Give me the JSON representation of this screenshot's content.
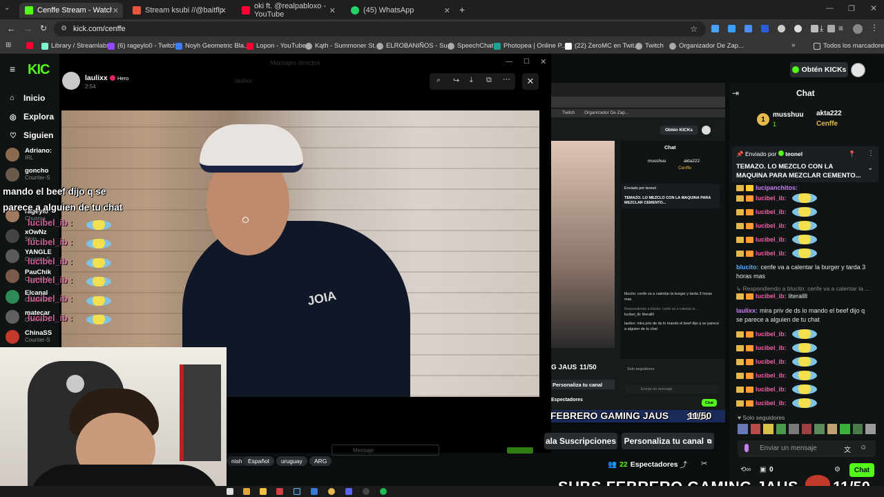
{
  "browser": {
    "tabs": [
      {
        "title": "Cenffe Stream - Watch Live on K",
        "color": "#53fc18",
        "active": true
      },
      {
        "title": "Stream ksubi //@baitflp",
        "color": "#e8553a",
        "active": false
      },
      {
        "title": "oki ft. @realpabloxo - YouTube",
        "color": "#ff0033",
        "active": false
      },
      {
        "title": "(45) WhatsApp",
        "color": "#25d366",
        "active": false
      }
    ],
    "url": "kick.com/cenffe",
    "bookmarks": [
      {
        "label": "",
        "color": "#ff0033"
      },
      {
        "label": "Library / Streamlabs",
        "color": "#80f5d2"
      },
      {
        "label": "(6) rageylo0 - Twitch",
        "color": "#9146ff"
      },
      {
        "label": "Noyh Geometric Bla...",
        "color": "#3c7cff"
      },
      {
        "label": "Lopon - YouTube",
        "color": "#ff0033"
      },
      {
        "label": "Kąth - Summoner St...",
        "color": "#aaaaaa"
      },
      {
        "label": "ELROBANIÑOS - Su...",
        "color": "#aaaaaa"
      },
      {
        "label": "SpeechChat",
        "color": "#aaaaaa"
      },
      {
        "label": "Photopea | Online P...",
        "color": "#18a497"
      },
      {
        "label": "(22) ZeroMC en Twit...",
        "color": "#ffffff"
      },
      {
        "label": "Twitch",
        "color": "#aaaaaa"
      },
      {
        "label": "Organizador De Zap...",
        "color": "#aaaaaa"
      }
    ],
    "all_bookmarks": "Todos los marcadores"
  },
  "sidebar": {
    "nav": [
      {
        "label": "Inicio",
        "icon": "home-icon"
      },
      {
        "label": "Explora",
        "icon": "compass-icon"
      },
      {
        "label": "Siguien",
        "icon": "heart-icon"
      }
    ],
    "channels": [
      {
        "name": "Adriano:",
        "sub": "IRL",
        "color": "#8c6a4f"
      },
      {
        "name": "goncho",
        "sub": "Counter-S",
        "color": "#6b5a4a"
      },
      {
        "name": "lucibel_ib",
        "sub": "Convers",
        "color": "#4c4c4c"
      },
      {
        "name": "rageylo",
        "sub": "Chusma",
        "color": "#a07a60"
      },
      {
        "name": "xOwNz",
        "sub": "Slots",
        "color": "#444444"
      },
      {
        "name": "YANGLE",
        "sub": "Counter-S",
        "color": "#5a5a5a"
      },
      {
        "name": "PauChik",
        "sub": "Counter-S",
        "color": "#7a5a4a"
      },
      {
        "name": "Elcanal",
        "sub": "Counter-S",
        "color": "#2e8b57"
      },
      {
        "name": "matecar",
        "sub": "Counter-S",
        "color": "#606060"
      },
      {
        "name": "ChinaSS",
        "sub": "Counter-S",
        "color": "#c0392b"
      }
    ]
  },
  "viewer": {
    "author": "laulixx",
    "badge": "Hero",
    "time": "2:54",
    "bg_author": "laulixx",
    "bg_text": "Mensajes directos"
  },
  "overlay": {
    "message_line1": "mando el beef dijo q se",
    "message_line2": "parece a alguien de tu chat",
    "pink_user": "lucibel_ib :"
  },
  "stream": {
    "tags": [
      "nish",
      "Español",
      "uruguay",
      "ARG"
    ],
    "message_placeholder": "Mensaje"
  },
  "header": {
    "get_kicks": "Obtén KICKs"
  },
  "chat": {
    "title": "Chat",
    "top_gifters": [
      {
        "name": "musshuu",
        "count": "1"
      },
      {
        "name": "akta222",
        "count": "1"
      },
      {
        "name": "Cenffe",
        "count": "1"
      }
    ],
    "pinned_by_label": "Enviado por",
    "pinned_by": "teonel",
    "pinned_text": "TEMAZO. LO MEZCLO CON LA MAQUINA PARA MEZCLAR CEMENTO...",
    "messages_top": [
      {
        "user": "lucipanchitos:",
        "text": ""
      },
      {
        "user": "lucibel_ib:",
        "text": ""
      },
      {
        "user": "lucibel_ib:",
        "text": ""
      },
      {
        "user": "lucibel_ib:",
        "text": ""
      },
      {
        "user": "lucibel_ib:",
        "text": ""
      },
      {
        "user": "lucibel_ib:",
        "text": ""
      }
    ],
    "msg_blucito_user": "blucito:",
    "msg_blucito_text": "cenfe va a calentar la burger y tarda 3",
    "msg_blucito_text2": "horas mas",
    "reply_label": "Respondiendo a blucito: cenfe va a calentar la ...",
    "reply_user": "lucibel_ib:",
    "reply_text": "literallll",
    "laulixx_user": "laulixx:",
    "laulixx_text": "mira priv de ds lo mando el beef dijo q",
    "laulixx_text2": "se parece a alguien de tu chat",
    "messages_bottom": [
      "lucibel_ib:",
      "lucibel_ib:",
      "lucibel_ib:",
      "lucibel_ib:",
      "lucibel_ib:",
      "lucibel_ib:"
    ],
    "followers_only": "Solo seguidores",
    "input_placeholder": "Enviar un mensaje",
    "points": "0",
    "send_label": "Chat",
    "subs_text": "SUBS FEBRERO GAMING JAUS",
    "subs_count": "11/50",
    "subs_embed": "FEBRERO GAMING JAUS",
    "personalize": "Personaliza tu canal",
    "subscriptions": "ala Suscripciones",
    "viewers": "22",
    "viewers_label": "Espectadores"
  },
  "embed": {
    "chat_title": "Chat",
    "get_kicks": "Obtén KICKs",
    "gifters": [
      "musshuu",
      "akta222",
      "Cenffe"
    ],
    "pinned_by_label": "Enviado por",
    "pinned_by": "teonel",
    "pinned_text": "TEMAZO. LO MEZCLO CON LA MAQUINA PARA MEZCLAR CEMENTO...",
    "blucito": "blucito: cenfe va a calentar la burger y tarda 3 horas mas",
    "reply": "Respondiendo a blucito: cenfe va a calentar la ...",
    "literal": "lucibel_ib: literallll",
    "laulixx": "laulixx: mira priv de ds lo mando el beef dijo q se parece a alguien de tu chat",
    "followers_only": "Solo seguidores",
    "input_placeholder": "Enviar un mensaje",
    "send": "Chat",
    "subs": "G JAUS",
    "subs_count": "11/50",
    "personalize": "Personaliza tu canal",
    "viewers_label": "Espectadores",
    "bookmark1": "Twitch",
    "bookmark2": "Organizador De Zap..."
  }
}
